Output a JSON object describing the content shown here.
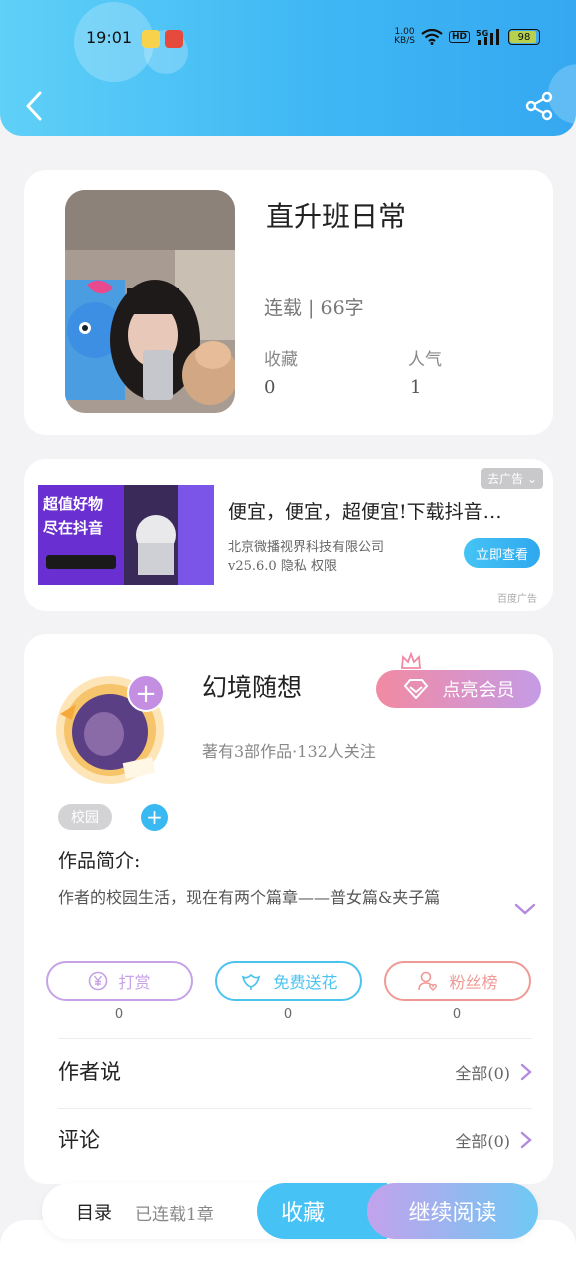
{
  "status_bar": {
    "time": "19:01",
    "net_speed_top": "1.00",
    "net_speed_unit": "KB/S",
    "hd": "HD",
    "signal": "5G",
    "battery": "98"
  },
  "book": {
    "title": "直升班日常",
    "status": "连载 | 66字",
    "favorites_label": "收藏",
    "favorites_value": "0",
    "popularity_label": "人气",
    "popularity_value": "1"
  },
  "ad": {
    "close_label": "去广告",
    "image_text1": "超值好物",
    "image_text2": "尽在抖音",
    "title": "便宜，便宜，超便宜!下载抖音…",
    "company": "北京微播视界科技有限公司",
    "meta": "v25.6.0  隐私  权限",
    "cta": "立即查看",
    "source": "百度广告"
  },
  "author": {
    "name": "幻境随想",
    "vip_label": "点亮会员",
    "info": "著有3部作品·132人关注",
    "tag": "校园",
    "intro_heading": "作品简介:",
    "intro_text": "作者的校园生活，现在有两个篇章——普女篇&夹子篇"
  },
  "actions": [
    {
      "label": "打赏",
      "count": "0",
      "color": "#c6a3e6"
    },
    {
      "label": "免费送花",
      "count": "0",
      "color": "#4cc3ef"
    },
    {
      "label": "粉丝榜",
      "count": "0",
      "color": "#f09a96"
    }
  ],
  "rows": {
    "author_says": {
      "label": "作者说",
      "right": "全部(0)"
    },
    "comments": {
      "label": "评论",
      "right": "全部(0)"
    }
  },
  "bottom": {
    "toc": "目录",
    "toc_sub": "已连载1章",
    "favorite": "收藏",
    "continue": "继续阅读"
  },
  "colors": {
    "header_start": "#5fd0f7",
    "header_end": "#35a8f1",
    "accent_purple": "#c59be6"
  }
}
